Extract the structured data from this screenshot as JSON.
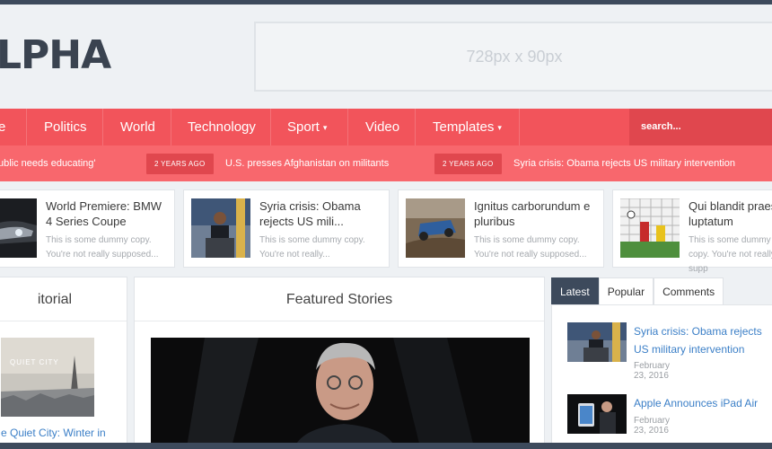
{
  "header": {
    "logo": "LPHA",
    "ad_text": "728px x 90px"
  },
  "nav": {
    "items": [
      {
        "label": "e",
        "dropdown": false
      },
      {
        "label": "Politics",
        "dropdown": false
      },
      {
        "label": "World",
        "dropdown": false
      },
      {
        "label": "Technology",
        "dropdown": false
      },
      {
        "label": "Sport",
        "dropdown": true
      },
      {
        "label": "Video",
        "dropdown": false
      },
      {
        "label": "Templates",
        "dropdown": true
      }
    ],
    "search_placeholder": "search..."
  },
  "ticker": {
    "items": [
      {
        "text": "ublic needs educating'"
      },
      {
        "badge": "2 YEARS AGO",
        "text": "U.S. presses Afghanistan on militants"
      },
      {
        "badge": "2 YEARS AGO",
        "text": "Syria crisis: Obama rejects US military intervention"
      }
    ]
  },
  "cards": [
    {
      "title": "World Premiere: BMW 4 Series Coupe",
      "desc": "This is some dummy copy. You're not really supposed..."
    },
    {
      "title": "Syria crisis: Obama rejects US mili...",
      "desc": "This is some dummy copy. You're not really..."
    },
    {
      "title": "Ignitus carborundum e pluribus",
      "desc": "This is some dummy copy. You're not really supposed..."
    },
    {
      "title": "Qui blandit praes luptatum",
      "desc": "This is some dummy copy. You're not really supp"
    }
  ],
  "editorial": {
    "heading": "itorial",
    "image_text": "QUIET CITY",
    "caption": "e Quiet City: Winter in"
  },
  "featured": {
    "heading": "Featured Stories"
  },
  "sidebar": {
    "tabs": [
      "Latest",
      "Popular",
      "Comments"
    ],
    "items": [
      {
        "title": "Syria crisis: Obama rejects US military intervention",
        "date": "February 23, 2016"
      },
      {
        "title": "Apple Announces iPad Air",
        "date": "February 23, 2016"
      }
    ]
  },
  "colors": {
    "nav": "#f2545b",
    "ticker": "#f8676d",
    "dark": "#3d4a5c",
    "link": "#3b7fc7"
  }
}
